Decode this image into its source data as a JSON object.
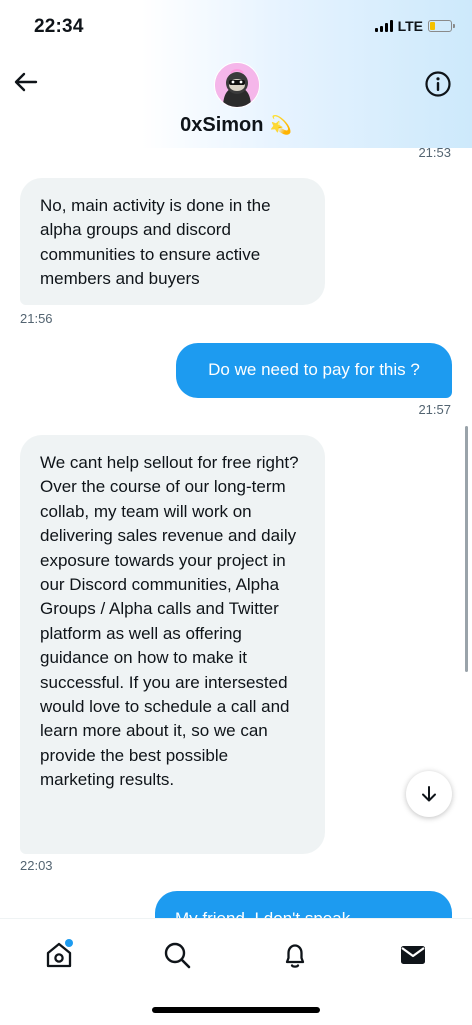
{
  "status_bar": {
    "time": "22:34",
    "network": "LTE",
    "battery_level": 0.2
  },
  "header": {
    "back_icon": "arrow-left-icon",
    "info_icon": "info-icon",
    "contact_name": "0xSimon",
    "name_emoji": "💫"
  },
  "messages": {
    "top_timestamp": "21:53",
    "m1": {
      "direction": "incoming",
      "text": "No, main activity is done in the alpha groups and discord communities to ensure active members and buyers",
      "time": "21:56"
    },
    "m2": {
      "direction": "outgoing",
      "text": "Do we need to pay for this ?",
      "time": "21:57"
    },
    "m3": {
      "direction": "incoming",
      "text": "We cant help sellout for free right? Over the course of our long-term collab, my team will work on delivering sales revenue and daily exposure towards your project in our Discord communities, Alpha Groups / Alpha calls and Twitter platform as well as offering guidance on how to make it successful. If you are intersested would love to schedule a call and learn more about it, so we can provide the best possible marketing results.",
      "time": "22:03"
    },
    "m4": {
      "direction": "outgoing",
      "text": "My friend, I don't speak"
    }
  },
  "bottom_nav": {
    "items": [
      "home-icon",
      "search-icon",
      "notifications-icon",
      "messages-icon"
    ],
    "active_color": "#000000",
    "dot_color": "#1d9bf0"
  },
  "colors": {
    "accent": "#1d9bf0",
    "incoming_bubble": "#eff3f4",
    "timestamp": "#536471"
  }
}
